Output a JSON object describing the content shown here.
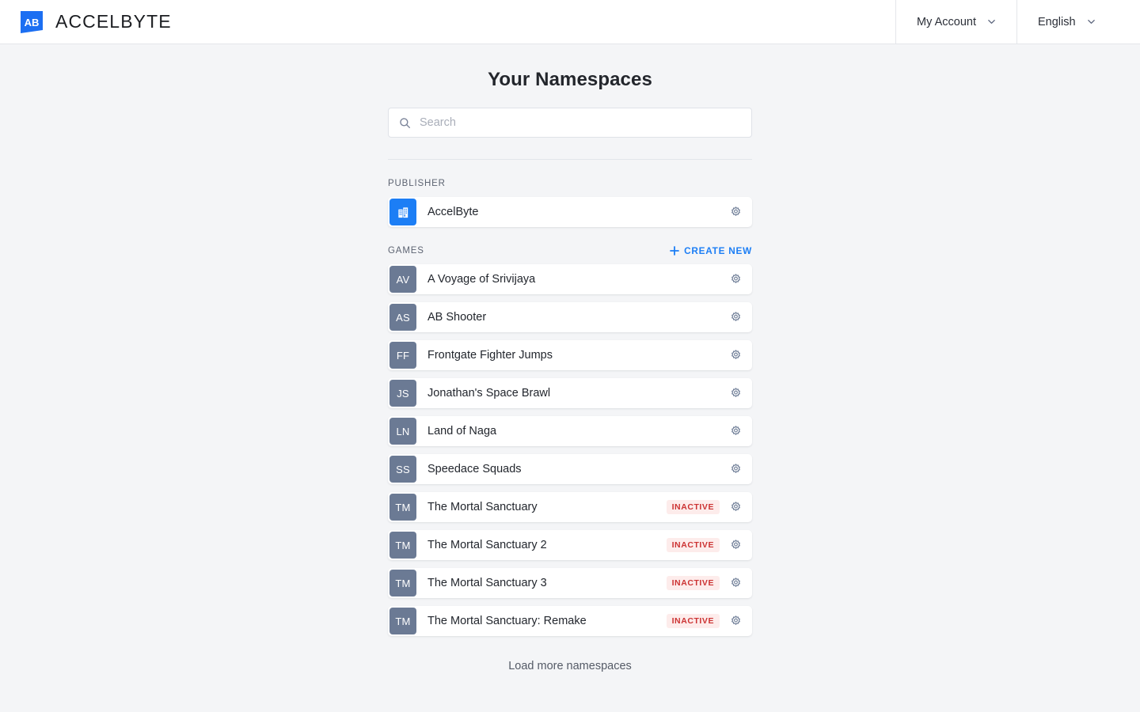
{
  "header": {
    "brand": {
      "name": "ACCELBYTE",
      "logo_icon": "accelbyte-logo-icon"
    },
    "account_menu": {
      "label": "My Account",
      "icon": "chevron-down-icon"
    },
    "language_menu": {
      "label": "English",
      "icon": "chevron-down-icon"
    }
  },
  "main": {
    "title": "Your Namespaces",
    "search": {
      "placeholder": "Search",
      "value": "",
      "icon": "search-icon"
    },
    "publisher_section": {
      "label": "PUBLISHER",
      "rows": [
        {
          "name": "AccelByte",
          "icon": "building-icon",
          "status": "",
          "settings_icon": "gear-icon"
        }
      ]
    },
    "games_section": {
      "label": "GAMES",
      "create_new": {
        "label": "CREATE NEW",
        "icon": "plus-icon"
      },
      "rows": [
        {
          "initials": "AV",
          "name": "A Voyage of Srivijaya",
          "status": "",
          "settings_icon": "gear-icon"
        },
        {
          "initials": "AS",
          "name": "AB Shooter",
          "status": "",
          "settings_icon": "gear-icon"
        },
        {
          "initials": "FF",
          "name": "Frontgate Fighter Jumps",
          "status": "",
          "settings_icon": "gear-icon"
        },
        {
          "initials": "JS",
          "name": "Jonathan's Space Brawl",
          "status": "",
          "settings_icon": "gear-icon"
        },
        {
          "initials": "LN",
          "name": "Land of Naga",
          "status": "",
          "settings_icon": "gear-icon"
        },
        {
          "initials": "SS",
          "name": "Speedace Squads",
          "status": "",
          "settings_icon": "gear-icon"
        },
        {
          "initials": "TM",
          "name": "The Mortal Sanctuary",
          "status": "INACTIVE",
          "settings_icon": "gear-icon"
        },
        {
          "initials": "TM",
          "name": "The Mortal Sanctuary 2",
          "status": "INACTIVE",
          "settings_icon": "gear-icon"
        },
        {
          "initials": "TM",
          "name": "The Mortal Sanctuary 3",
          "status": "INACTIVE",
          "settings_icon": "gear-icon"
        },
        {
          "initials": "TM",
          "name": "The Mortal Sanctuary: Remake",
          "status": "INACTIVE",
          "settings_icon": "gear-icon"
        }
      ]
    },
    "load_more": {
      "label": "Load more namespaces"
    }
  },
  "colors": {
    "brand_blue": "#1c7ef5",
    "page_background": "#f4f5f7",
    "card_background": "#ffffff",
    "avatar_game": "#6b7a94",
    "badge_text": "#cc3333",
    "badge_background": "#fdeceb",
    "icon_muted": "#6b7a94"
  }
}
